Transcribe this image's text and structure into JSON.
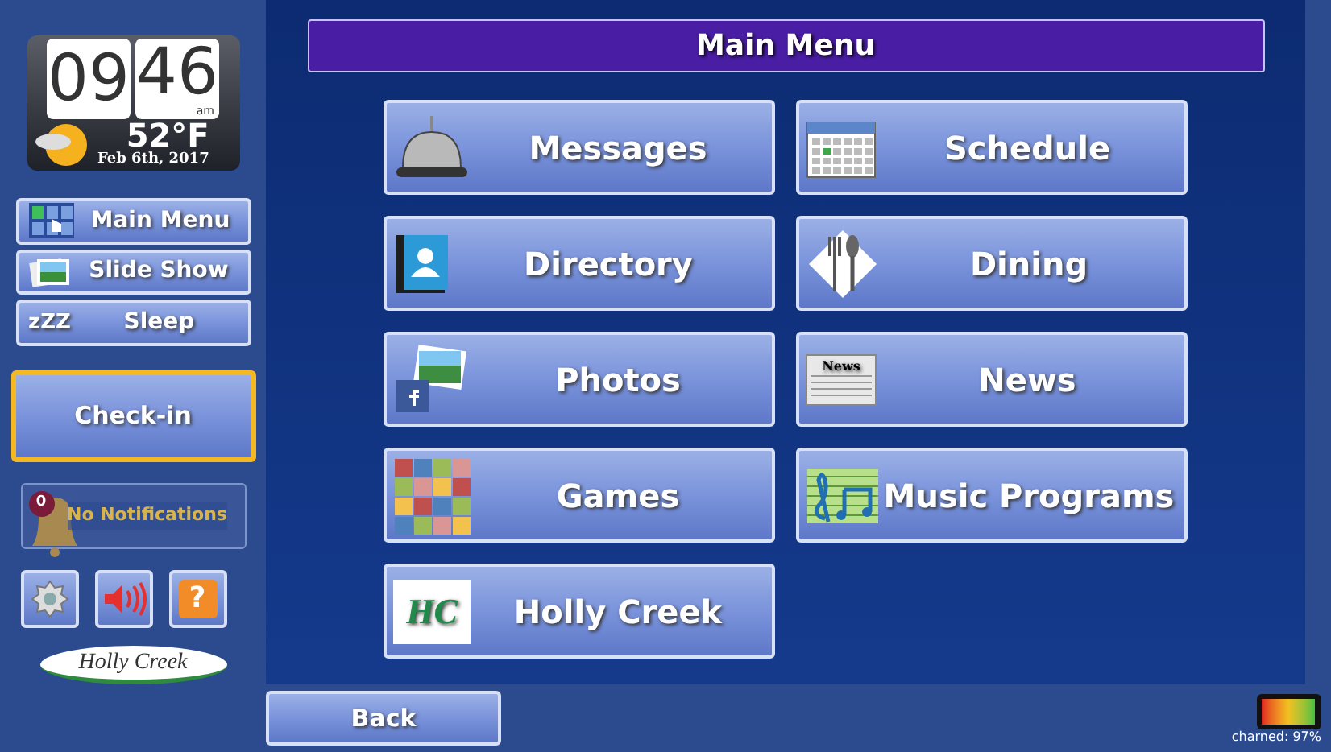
{
  "clock": {
    "hours": "09",
    "minutes": "46",
    "period": "am",
    "temperature": "52°F",
    "date": "Feb 6th, 2017"
  },
  "sidebar": {
    "items": [
      {
        "label": "Main Menu",
        "kind": "grid"
      },
      {
        "label": "Slide Show",
        "kind": "photos"
      },
      {
        "label": "Sleep",
        "kind": "sleep",
        "icon_text": "zZZ"
      }
    ],
    "check_in": {
      "label": "Check-in",
      "selected": true
    },
    "notifications": {
      "count": "0",
      "label": "No Notifications"
    },
    "tools": [
      {
        "kind": "settings"
      },
      {
        "kind": "sound"
      },
      {
        "kind": "help",
        "icon_text": "?"
      }
    ],
    "logo": "Holly Creek"
  },
  "main_menu": {
    "title": "Main Menu",
    "tiles": [
      {
        "label": "Messages",
        "kind": "bell"
      },
      {
        "label": "Schedule",
        "kind": "calendar"
      },
      {
        "label": "Directory",
        "kind": "contacts"
      },
      {
        "label": "Dining",
        "kind": "dining"
      },
      {
        "label": "Photos",
        "kind": "photos"
      },
      {
        "label": "News",
        "kind": "news",
        "icon_text": "News"
      },
      {
        "label": "Games",
        "kind": "games"
      },
      {
        "label": "Music Programs",
        "kind": "music"
      },
      {
        "label": "Holly Creek",
        "kind": "logo",
        "icon_text": "HC"
      }
    ]
  },
  "bottom_bar": {
    "back": "Back",
    "battery": {
      "level": 0.97,
      "reading": "charned: 97%"
    }
  }
}
